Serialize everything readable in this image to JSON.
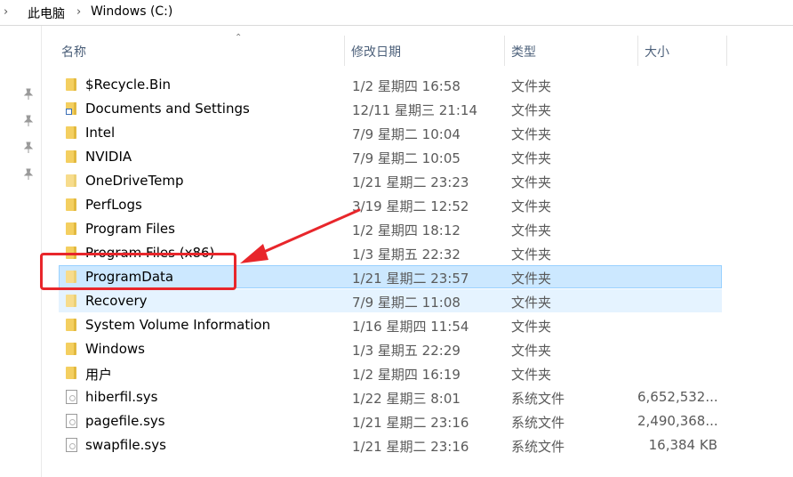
{
  "breadcrumb": {
    "items": [
      "此电脑",
      "Windows (C:)"
    ]
  },
  "columns": {
    "name": "名称",
    "date": "修改日期",
    "type": "类型",
    "size": "大小"
  },
  "rows": [
    {
      "name": "$Recycle.Bin",
      "date": "1/2 星期四 16:58",
      "type": "文件夹",
      "size": "",
      "icon": "folder-icon"
    },
    {
      "name": "Documents and Settings",
      "date": "12/11 星期三 21:14",
      "type": "文件夹",
      "size": "",
      "icon": "folder-shortcut-icon"
    },
    {
      "name": "Intel",
      "date": "7/9 星期二 10:04",
      "type": "文件夹",
      "size": "",
      "icon": "folder-icon"
    },
    {
      "name": "NVIDIA",
      "date": "7/9 星期二 10:05",
      "type": "文件夹",
      "size": "",
      "icon": "folder-icon"
    },
    {
      "name": "OneDriveTemp",
      "date": "1/21 星期二 23:23",
      "type": "文件夹",
      "size": "",
      "icon": "folder-icon"
    },
    {
      "name": "PerfLogs",
      "date": "3/19 星期二 12:52",
      "type": "文件夹",
      "size": "",
      "icon": "folder-icon"
    },
    {
      "name": "Program Files",
      "date": "1/2 星期四 18:12",
      "type": "文件夹",
      "size": "",
      "icon": "folder-icon"
    },
    {
      "name": "Program Files (x86)",
      "date": "1/3 星期五 22:32",
      "type": "文件夹",
      "size": "",
      "icon": "folder-icon"
    },
    {
      "name": "ProgramData",
      "date": "1/21 星期二 23:57",
      "type": "文件夹",
      "size": "",
      "icon": "folder-icon",
      "state": "selected"
    },
    {
      "name": "Recovery",
      "date": "7/9 星期二 11:08",
      "type": "文件夹",
      "size": "",
      "icon": "folder-icon",
      "state": "hover"
    },
    {
      "name": "System Volume Information",
      "date": "1/16 星期四 11:54",
      "type": "文件夹",
      "size": "",
      "icon": "folder-icon"
    },
    {
      "name": "Windows",
      "date": "1/3 星期五 22:29",
      "type": "文件夹",
      "size": "",
      "icon": "folder-icon"
    },
    {
      "name": "用户",
      "date": "1/2 星期四 16:19",
      "type": "文件夹",
      "size": "",
      "icon": "folder-icon"
    },
    {
      "name": "hiberfil.sys",
      "date": "1/22 星期三 8:01",
      "type": "系统文件",
      "size": "6,652,532...",
      "icon": "system-file-icon"
    },
    {
      "name": "pagefile.sys",
      "date": "1/21 星期二 23:16",
      "type": "系统文件",
      "size": "2,490,368...",
      "icon": "system-file-icon"
    },
    {
      "name": "swapfile.sys",
      "date": "1/21 星期二 23:16",
      "type": "系统文件",
      "size": "16,384 KB",
      "icon": "system-file-icon"
    }
  ],
  "colors": {
    "selected_bg": "#cce8ff",
    "hover_bg": "#e5f3ff",
    "annotation": "#e8262b",
    "folder": "#f4cf60"
  }
}
